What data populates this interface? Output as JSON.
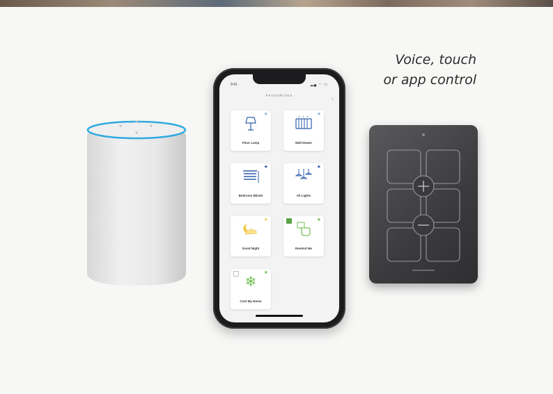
{
  "tagline": {
    "line1": "Voice, touch",
    "line2": "or app control"
  },
  "phone": {
    "status_time": "9:41",
    "header": "FAVOURITES",
    "tiles": [
      {
        "label": "Floor Lamp",
        "icon": "floor-lamp-icon",
        "glyph": "🛋",
        "star_color": "#8fb3d9",
        "checkbox": false
      },
      {
        "label": "Wall Heater",
        "icon": "wall-heater-icon",
        "glyph": "▤",
        "star_color": "#8fb3d9",
        "checkbox": false
      },
      {
        "label": "Bedroom Blinds",
        "icon": "blinds-icon",
        "glyph": "☰",
        "star_color": "#2d5ea8",
        "checkbox": false
      },
      {
        "label": "All Lights",
        "icon": "pendant-lights-icon",
        "glyph": "⚲",
        "star_color": "#2d5ea8",
        "checkbox": false
      },
      {
        "label": "Good Night",
        "icon": "moon-cloud-icon",
        "glyph": "☾",
        "star_color": "#f2c94c",
        "checkbox": false
      },
      {
        "label": "Remind Me",
        "icon": "hand-tap-icon",
        "glyph": "☝",
        "star_color": "#6fbf4f",
        "checkbox": true,
        "checked": true
      },
      {
        "label": "Cool My Home",
        "icon": "snowflake-icon",
        "glyph": "❄",
        "star_color": "#6fbf4f",
        "checkbox": true,
        "checked": false
      }
    ]
  },
  "colors": {
    "accent_ring": "#2fa9e0",
    "icon_blue": "#2d5ea8",
    "icon_yellow": "#f2c94c",
    "icon_green": "#6fbf4f"
  }
}
